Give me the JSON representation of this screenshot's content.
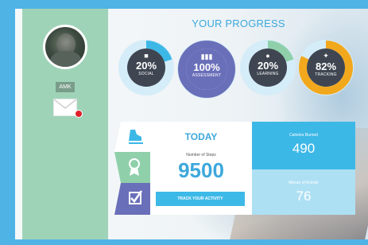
{
  "header": {
    "title": "YOUR PROGRESS"
  },
  "profile": {
    "username": "AMK",
    "mail_icon": "envelope-icon",
    "has_notification": true
  },
  "progress": [
    {
      "value": "20%",
      "label": "SOCIAL",
      "icon": "camera-icon",
      "fraction": 0.2,
      "color": "#3cb8e6"
    },
    {
      "value": "100%",
      "label": "ASSESSMENT",
      "icon": "bar-chart-icon",
      "fraction": 1.0,
      "color": "#6a6fb9"
    },
    {
      "value": "20%",
      "label": "LEARNING",
      "icon": "apple-icon",
      "fraction": 0.2,
      "color": "#8fd0ab"
    },
    {
      "value": "82%",
      "label": "TRACKING",
      "icon": "shoe-icon",
      "fraction": 0.82,
      "color": "#f2a81d"
    }
  ],
  "tabs": [
    {
      "name": "tab-activity",
      "icon": "shoe-icon",
      "color": "#ffffff"
    },
    {
      "name": "tab-achievements",
      "icon": "medal-icon",
      "color": "#8fd0ab"
    },
    {
      "name": "tab-checklist",
      "icon": "checkbox-icon",
      "color": "#6a6fb9"
    }
  ],
  "today": {
    "title": "TODAY",
    "steps_label": "Number of Steps",
    "steps_value": "9500",
    "button_label": "TRACK YOUR ACTIVITY"
  },
  "calories": {
    "label": "Calories Burned",
    "value": "490"
  },
  "minutes": {
    "label": "Minute of Activity",
    "value": "76"
  },
  "colors": {
    "accent": "#3da8dc",
    "sidebar": "#9fd3b8",
    "notification": "#e01f2a"
  }
}
